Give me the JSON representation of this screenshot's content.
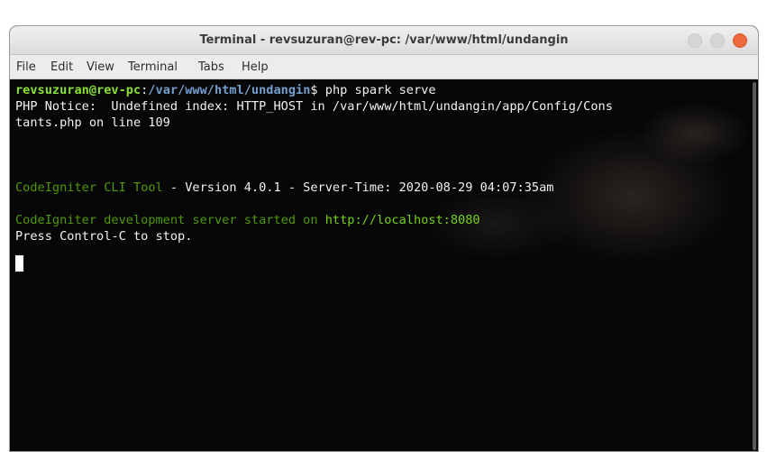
{
  "window": {
    "title": "Terminal - revsuzuran@rev-pc: /var/www/html/undangin"
  },
  "menu": {
    "items": [
      "File",
      "Edit",
      "View",
      "Terminal",
      "Tabs",
      "Help"
    ]
  },
  "terminal": {
    "prompt_user": "revsuzuran@rev-pc",
    "prompt_sep": ":",
    "prompt_path": "/var/www/html/undangin",
    "prompt_dollar": "$ ",
    "command": "php spark serve",
    "notice_line1": "PHP Notice:  Undefined index: HTTP_HOST in /var/www/html/undangin/app/Config/Cons",
    "notice_line2": "tants.php on line 109",
    "cli_tool": "CodeIgniter CLI Tool",
    "cli_rest": " - Version 4.0.1 - Server-Time: 2020-08-29 04:07:35am",
    "server_started": "CodeIgniter development server started on ",
    "server_url": "http://localhost:8080",
    "stop_hint": "Press Control-C to stop."
  },
  "colors": {
    "prompt_user": "#8ae234",
    "prompt_path": "#729fcf",
    "codeigniter_text": "#4e9a06",
    "url": "#73d216",
    "close_button": "#ef6a3d"
  }
}
